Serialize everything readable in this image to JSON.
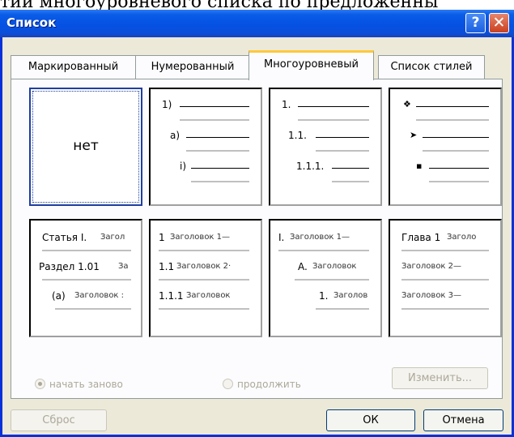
{
  "background_text": "тии многоуровневого списка по предложенны",
  "window": {
    "title": "Список"
  },
  "titlebar_buttons": {
    "help": "?",
    "close": "✕"
  },
  "tabs": [
    "Маркированный",
    "Нумерованный",
    "Многоуровневый",
    "Список стилей"
  ],
  "active_tab": "Многоуровневый",
  "gallery": {
    "none_label": "нет",
    "cell1": [
      "1)",
      "a)",
      "i)"
    ],
    "cell2": [
      "1.",
      "1.1.",
      "1.1.1."
    ],
    "cell3": [
      "❖",
      "➤",
      "▪"
    ],
    "cell4": [
      "Статья I.",
      "Загол",
      "Раздел 1.01",
      "За",
      "(a)",
      "Заголовок :"
    ],
    "cell5": [
      "1",
      "Заголовок 1—",
      "1.1",
      "Заголовок 2·",
      "1.1.1",
      "Заголовок"
    ],
    "cell6": [
      "I.",
      "Заголовок 1—",
      "A.",
      "Заголовок",
      "1.",
      "Заголов"
    ],
    "cell7": [
      "Глава 1",
      "Заголо",
      "Заголовок 2—",
      "Заголовок 3—"
    ]
  },
  "options": {
    "restart": "начать заново",
    "continue": "продолжить",
    "restart_selected": true
  },
  "buttons": {
    "change": "Изменить...",
    "reset": "Сброс",
    "ok": "ОК",
    "cancel": "Отмена"
  }
}
